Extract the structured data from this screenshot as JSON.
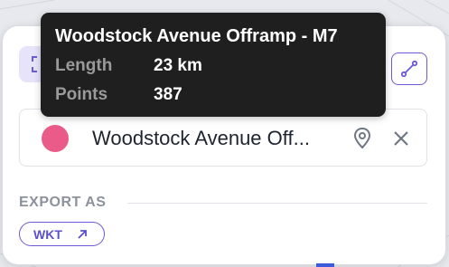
{
  "tooltip": {
    "title": "Woodstock Avenue Offramp - M7",
    "length_label": "Length",
    "length_value": "23 km",
    "points_label": "Points",
    "points_value": "387"
  },
  "location": {
    "name": "Woodstock Avenue Off...",
    "color": "#ea5b8a"
  },
  "export": {
    "label": "EXPORT AS",
    "wkt_label": "WKT"
  },
  "colors": {
    "accent": "#6b5bd6",
    "tooltip_bg": "#1f1f1f",
    "panel_bg": "#ffffff"
  }
}
